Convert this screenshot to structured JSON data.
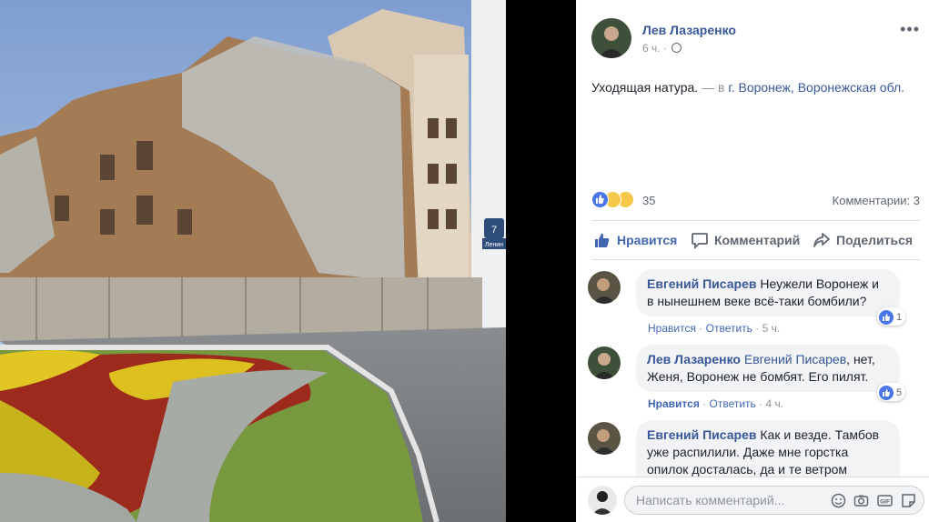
{
  "post": {
    "author": "Лев Лазаренко",
    "time": "6 ч.",
    "separator": "·",
    "text": "Уходящая натура.",
    "checkin_prefix": "— в",
    "place": "г. Воронеж, Воронежская обл.",
    "more_label": "•••",
    "reaction_count": "35",
    "comments_count": "Комментарии: 3"
  },
  "actions": {
    "like": "Нравится",
    "comment": "Комментарий",
    "share": "Поделиться"
  },
  "comments": [
    {
      "author": "Евгений Писарев",
      "text": "Неужели Воронеж и в нынешнем веке всё-таки бомбили?",
      "like_label": "Нравится",
      "reply_label": "Ответить",
      "time": "5 ч.",
      "likes": "1",
      "liked": false
    },
    {
      "author": "Лев Лазаренко",
      "mention": "Евгений Писарев",
      "text": ", нет, Женя, Воронеж не бомбят. Его пилят.",
      "like_label": "Нравится",
      "reply_label": "Ответить",
      "time": "4 ч.",
      "likes": "5",
      "liked": true
    },
    {
      "author": "Евгений Писарев",
      "text": "Как и везде. Тамбов уже распилили. Даже мне горстка опилок досталась, да и те ветром унесло.",
      "like_label": "",
      "reply_label": "",
      "time": "",
      "likes": "",
      "liked": false
    }
  ],
  "composer": {
    "placeholder": "Написать комментарий..."
  },
  "photo": {
    "sign_number": "7",
    "sign_text": "Ленин"
  },
  "colors": {
    "link": "#385898",
    "accent": "#4267b2",
    "muted": "#90949c",
    "bubble": "#f2f3f5"
  }
}
